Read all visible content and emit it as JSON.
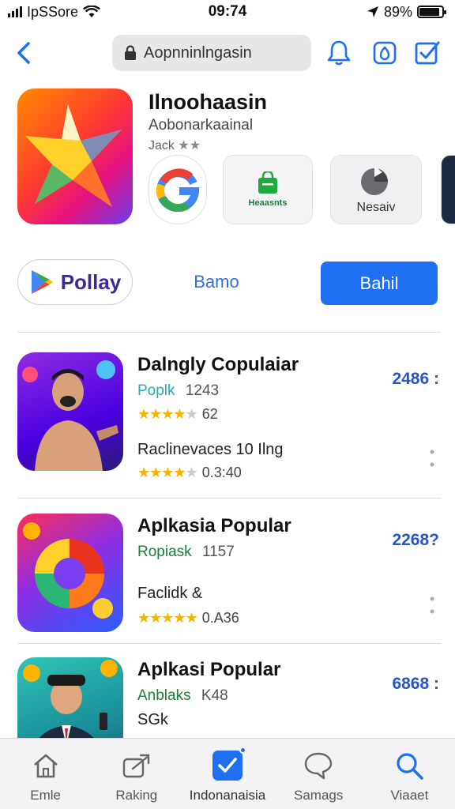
{
  "status_bar": {
    "carrier": "IpSSore",
    "time": "09:74",
    "battery_text": "89%",
    "battery_level": 0.89
  },
  "nav": {
    "search_text": "Aopnninlngasin",
    "icons": [
      "back-chevron-icon",
      "lock-icon",
      "bell-icon",
      "camera-icon",
      "edit-checkbox-icon"
    ]
  },
  "featured": {
    "title": "Ilnoohaasin",
    "subtitle": "Aobonarkaainal",
    "meta": "Jack",
    "chips": {
      "store_label": "Heaasnts",
      "new_label": "Nesaiv"
    }
  },
  "actions": {
    "play_label": "Pollay",
    "demo_label": "Bamo",
    "primary_label": "Bahil"
  },
  "apps": [
    {
      "name": "Dalngly Copulaiar",
      "developer": "Poplk",
      "count": "1243",
      "stars": 4,
      "rating_count": "62",
      "subtitle2": "Raclinevaces 10 Ilng",
      "stars2": 4,
      "rating2": "0.3:40",
      "price": "2486 :",
      "developer_color": "#2aa7b8"
    },
    {
      "name": "Aplkasia Popular",
      "developer": "Ropiask",
      "count": "1157",
      "subtitle2": "Faclidk &",
      "stars2": 5,
      "rating2": "0.A36",
      "price": "2268?",
      "developer_color": "#1a7f37"
    },
    {
      "name": "Aplkasi Popular",
      "developer": "Anblaks",
      "count": "K48",
      "subtitle2": "SGk",
      "price": "6868 :",
      "developer_color": "#1a7f37"
    }
  ],
  "tabs": [
    {
      "label": "Emle",
      "icon": "home-icon"
    },
    {
      "label": "Raking",
      "icon": "share-icon"
    },
    {
      "label": "Indonanaisia",
      "icon": "checkbox-icon"
    },
    {
      "label": "Samags",
      "icon": "chat-bubble-icon"
    },
    {
      "label": "Viaaet",
      "icon": "search-icon"
    }
  ],
  "colors": {
    "accent": "#1f6ff2",
    "price": "#2456c9",
    "star": "#f5b400"
  }
}
